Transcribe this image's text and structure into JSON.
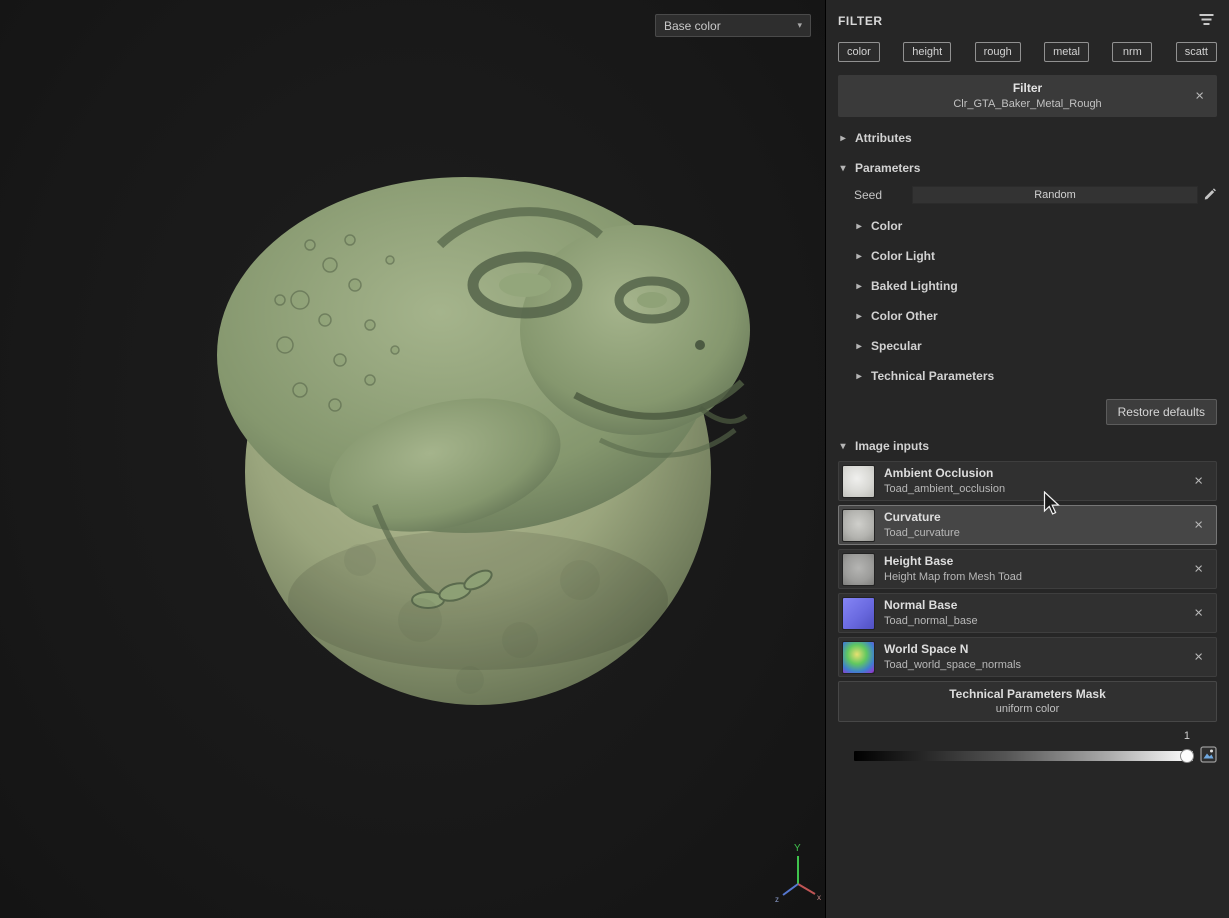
{
  "icons": {
    "chevron_right": "▸",
    "chevron_down": "▾",
    "caret_down": "▾",
    "close": "×"
  },
  "viewport": {
    "channel_dropdown": "Base color",
    "axis": {
      "x": "x",
      "y": "Y",
      "z": "z"
    }
  },
  "panel": {
    "title": "FILTER",
    "channels": [
      "color",
      "height",
      "rough",
      "metal",
      "nrm",
      "scatt"
    ],
    "filter_card": {
      "title": "Filter",
      "name": "Clr_GTA_Baker_Metal_Rough"
    },
    "attributes": {
      "label": "Attributes"
    },
    "parameters": {
      "label": "Parameters",
      "seed_label": "Seed",
      "seed_value": "Random",
      "groups": [
        "Color",
        "Color Light",
        "Baked Lighting",
        "Color Other",
        "Specular",
        "Technical Parameters"
      ],
      "restore_label": "Restore defaults"
    },
    "image_inputs": {
      "label": "Image inputs",
      "items": [
        {
          "name": "Ambient Occlusion",
          "source": "Toad_ambient_occlusion"
        },
        {
          "name": "Curvature",
          "source": "Toad_curvature"
        },
        {
          "name": "Height Base",
          "source": "Height Map from Mesh Toad"
        },
        {
          "name": "Normal Base",
          "source": "Toad_normal_base"
        },
        {
          "name": "World Space N",
          "source": "Toad_world_space_normals"
        }
      ],
      "mask": {
        "title": "Technical Parameters Mask",
        "subtitle": "uniform color"
      }
    },
    "opacity_slider": {
      "value": "1"
    }
  }
}
